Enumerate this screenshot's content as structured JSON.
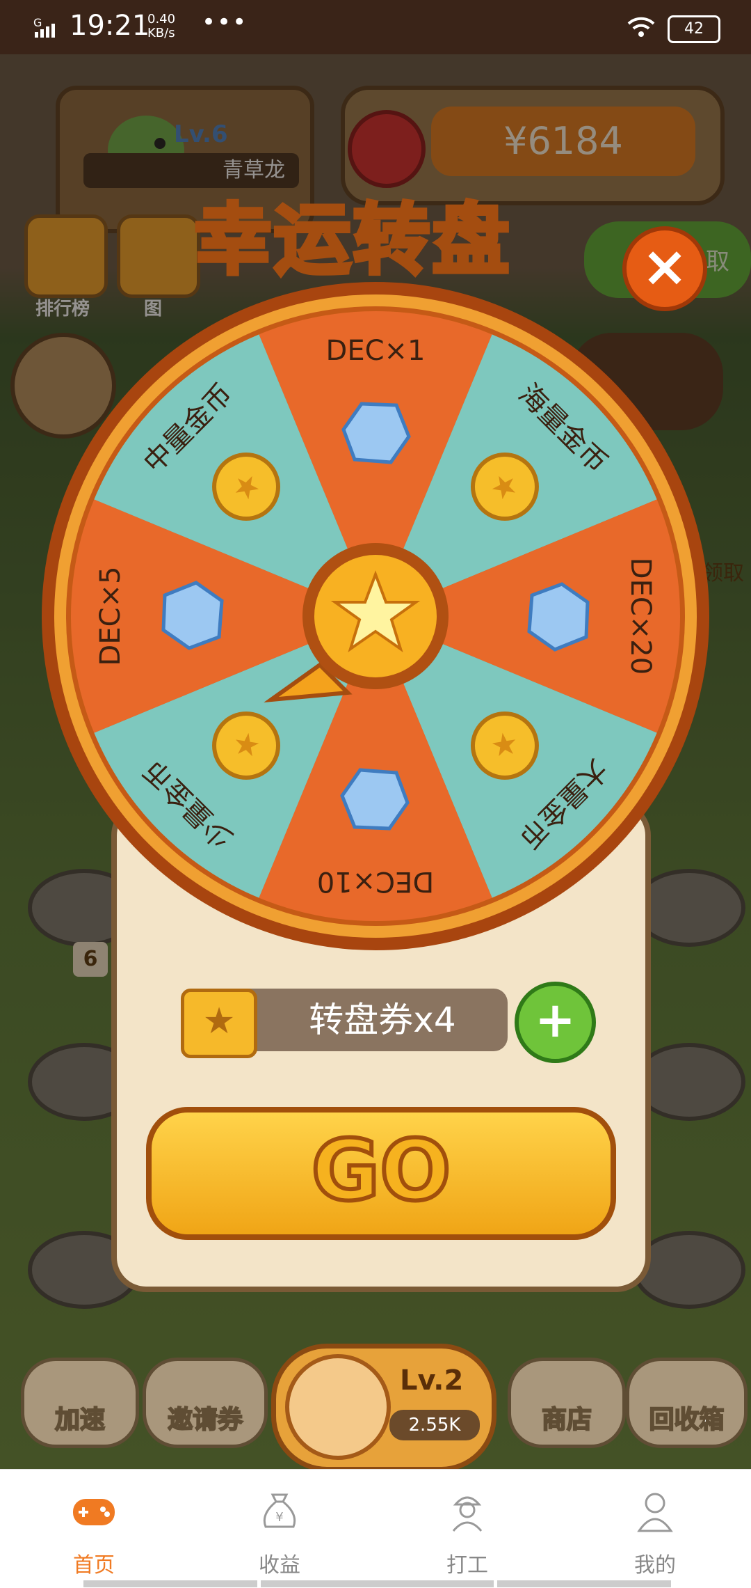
{
  "status_bar": {
    "carrier": "G",
    "time": "19:21",
    "speed_value": "0.40",
    "speed_unit": "KB/s",
    "menu_dots": "•••",
    "battery": "42"
  },
  "header": {
    "level": "Lv.6",
    "dragon_name": "青草龙",
    "money": "¥6184",
    "side_buttons": [
      "排行榜",
      "图"
    ],
    "claim_partial": "取",
    "claim_partial2": "领取"
  },
  "wheel": {
    "title": "幸运转盘",
    "close_label": "×",
    "segments": [
      {
        "label": "DEC×1",
        "prize": "diamond",
        "color": "#e8692a"
      },
      {
        "label": "海量金币",
        "prize": "coin",
        "color": "#7ec8be"
      },
      {
        "label": "DEC×20",
        "prize": "diamond",
        "color": "#e8692a"
      },
      {
        "label": "大量金币",
        "prize": "coin",
        "color": "#7ec8be"
      },
      {
        "label": "DEC×10",
        "prize": "diamond",
        "color": "#e8692a"
      },
      {
        "label": "少量金币",
        "prize": "coin",
        "color": "#7ec8be"
      },
      {
        "label": "DEC×5",
        "prize": "diamond",
        "color": "#e8692a"
      },
      {
        "label": "中量金币",
        "prize": "coin",
        "color": "#7ec8be"
      }
    ],
    "ticket_text": "转盘券x4",
    "plus_label": "+",
    "go_label": "GO"
  },
  "game_bar": {
    "speed_up": "加速",
    "invite": "邀请券",
    "center_level": "Lv.2",
    "center_coins": "2.55K",
    "shop": "商店",
    "recycle": "回收箱",
    "pedestal_badge": "6"
  },
  "nav": {
    "items": [
      {
        "label": "首页",
        "icon": "gamepad-icon",
        "active": true
      },
      {
        "label": "收益",
        "icon": "money-bag-icon",
        "active": false
      },
      {
        "label": "打工",
        "icon": "worker-icon",
        "active": false
      },
      {
        "label": "我的",
        "icon": "profile-icon",
        "active": false
      }
    ],
    "active_color": "#f07a22",
    "inactive_color": "#888888"
  }
}
